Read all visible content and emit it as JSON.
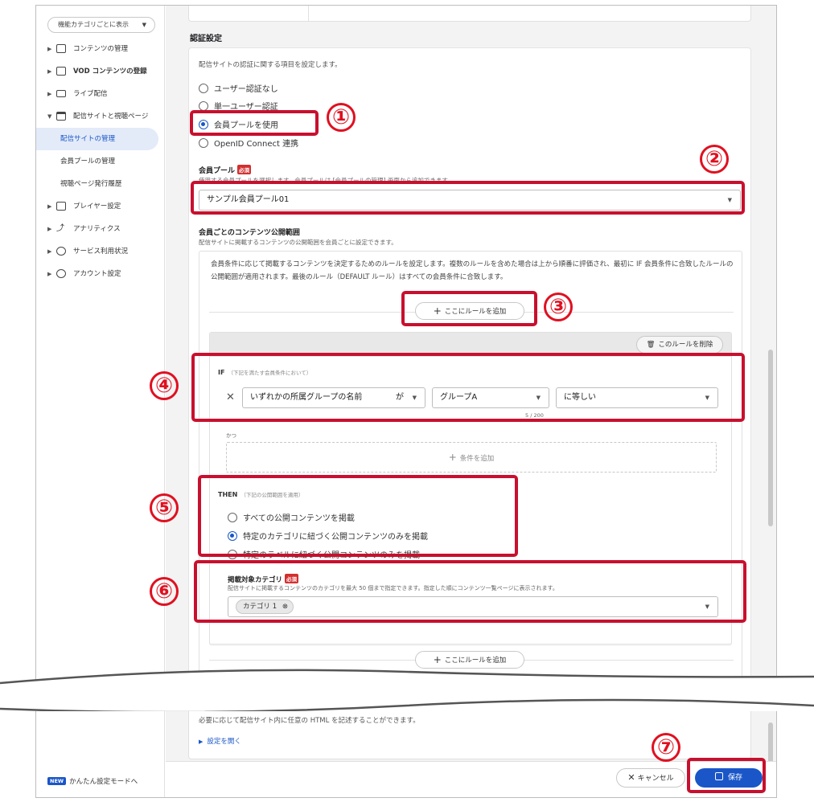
{
  "sidebar": {
    "category_select": "機能カテゴリごとに表示",
    "items": [
      {
        "label": "コンテンツの管理",
        "icon": "play-box-icon"
      },
      {
        "label": "VOD コンテンツの登録",
        "icon": "add-box-icon"
      },
      {
        "label": "ライブ配信",
        "icon": "camera-icon"
      },
      {
        "label": "配信サイトと視聴ページ",
        "icon": "window-icon"
      }
    ],
    "sub_items": [
      "配信サイトの管理",
      "会員プールの管理",
      "視聴ページ発行履歴"
    ],
    "items2": [
      {
        "label": "プレイヤー設定",
        "icon": "player-icon"
      },
      {
        "label": "アナリティクス",
        "icon": "analytics-icon"
      },
      {
        "label": "サービス利用状況",
        "icon": "usage-icon"
      },
      {
        "label": "アカウント設定",
        "icon": "account-icon"
      }
    ],
    "footer_badge": "NEW",
    "footer_label": "かんたん設定モードへ"
  },
  "auth": {
    "section_title": "認証設定",
    "description": "配信サイトの認証に関する項目を設定します。",
    "options": [
      "ユーザー認証なし",
      "単一ユーザー認証",
      "会員プールを使用",
      "OpenID Connect 連携"
    ],
    "selected_index": 2,
    "pool_label": "会員プール",
    "required": "必須",
    "pool_help": "使用する会員プールを選択します。会員プールは [会員プールの管理] 画面から追加できます。",
    "pool_value": "サンプル会員プール01"
  },
  "scope": {
    "label": "会員ごとのコンテンツ公開範囲",
    "help": "配信サイトに掲載するコンテンツの公開範囲を会員ごとに設定できます。",
    "rules_desc": "会員条件に応じて掲載するコンテンツを決定するためのルールを設定します。複数のルールを含めた場合は上から順番に評価され、最初に IF 会員条件に合致したルールの公開範囲が適用されます。最後のルール（DEFAULT ルール）はすべての会員条件に合致します。",
    "add_rule": "ここにルールを追加",
    "delete_rule": "このルールを削除",
    "if_label": "IF",
    "if_hint": "（下記を満たす会員条件において）",
    "cond_field": "いずれかの所属グループの名前",
    "cond_particle": "が",
    "cond_value": "グループA",
    "cond_counter": "5 / 200",
    "cond_op": "に等しい",
    "and_label": "かつ",
    "add_condition": "条件を追加",
    "then_label": "THEN",
    "then_hint": "（下記の公開範囲を適用）",
    "then_options": [
      "すべての公開コンテンツを掲載",
      "特定のカテゴリに紐づく公開コンテンツのみを掲載",
      "特定のラベルに紐づく公開コンテンツのみを掲載"
    ],
    "then_selected_index": 1,
    "cat_label": "掲載対象カテゴリ",
    "cat_help": "配信サイトに掲載するコンテンツのカテゴリを最大 50 個まで指定できます。指定した順にコンテンツ一覧ページに表示されます。",
    "cat_chip": "カテゴリ 1"
  },
  "bottom": {
    "html_desc": "必要に応じて配信サイト内に任意の HTML を記述することができます。",
    "open_settings": "設定を開く",
    "cancel": "キャンセル",
    "save": "保存"
  },
  "annotations": [
    "①",
    "②",
    "③",
    "④",
    "⑤",
    "⑥",
    "⑦"
  ],
  "colors": {
    "accent": "#1a56c8",
    "annotation_red": "#e01020",
    "required": "#d32f2f"
  }
}
